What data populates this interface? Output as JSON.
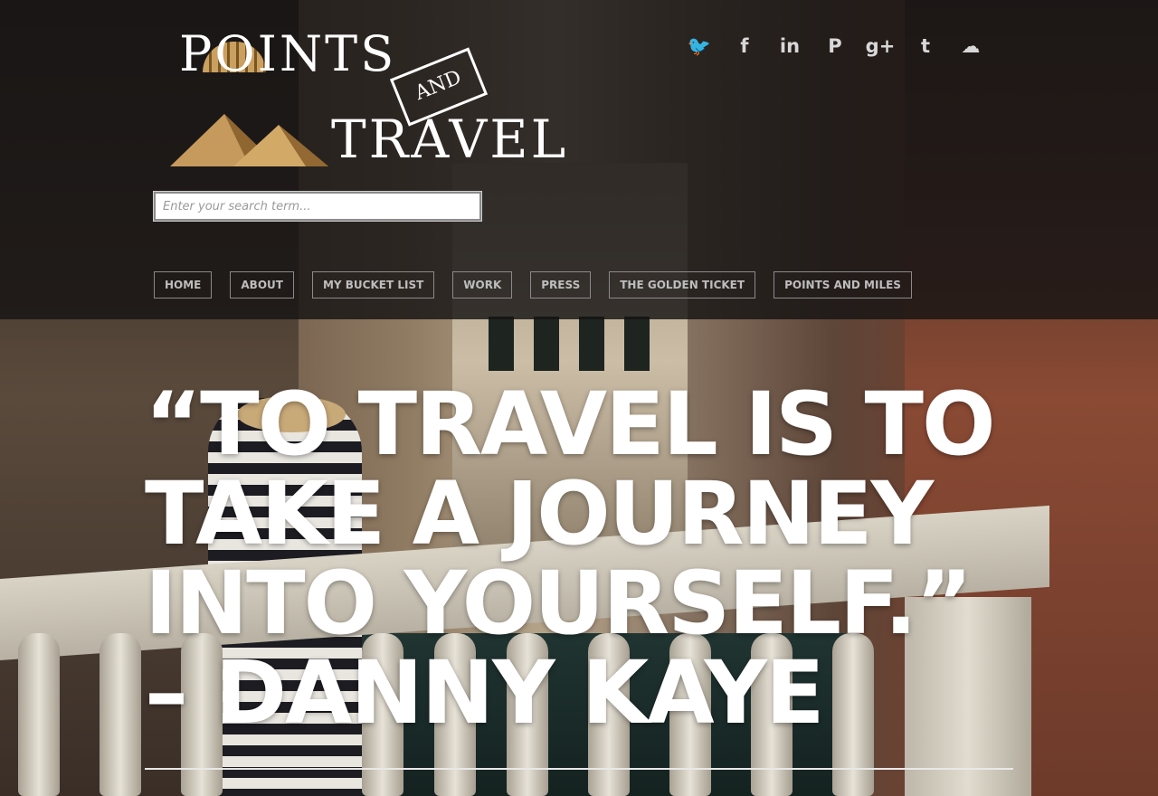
{
  "site": {
    "logo_line1": "POINTS",
    "logo_and": "AND",
    "logo_line2": "TRAVEL"
  },
  "search": {
    "placeholder": "Enter your search term..."
  },
  "social": [
    {
      "name": "twitter-icon",
      "glyph": "🐦"
    },
    {
      "name": "facebook-icon",
      "glyph": "f"
    },
    {
      "name": "linkedin-icon",
      "glyph": "in"
    },
    {
      "name": "pinterest-icon",
      "glyph": "P"
    },
    {
      "name": "googleplus-icon",
      "glyph": "g+"
    },
    {
      "name": "tumblr-icon",
      "glyph": "t"
    },
    {
      "name": "soundcloud-icon",
      "glyph": "☁"
    }
  ],
  "nav": [
    {
      "label": "HOME"
    },
    {
      "label": "ABOUT"
    },
    {
      "label": "MY BUCKET LIST"
    },
    {
      "label": "WORK"
    },
    {
      "label": "PRESS"
    },
    {
      "label": "THE GOLDEN TICKET"
    },
    {
      "label": "POINTS AND MILES"
    }
  ],
  "hero": {
    "quote": "“To travel is to take a journey into yourself.” – Danny Kaye"
  }
}
